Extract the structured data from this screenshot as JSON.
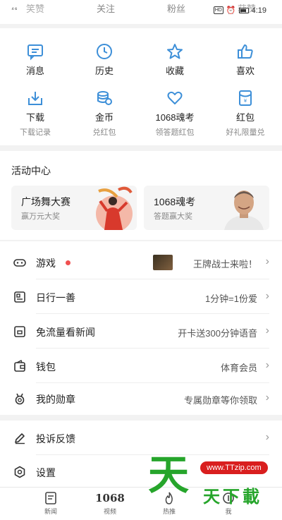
{
  "top_tabs": [
    "关注",
    "粉丝"
  ],
  "top_tabs_partial": [
    "笑赞",
    "获赞"
  ],
  "status": {
    "signal": "⁴⁶",
    "hd": "HD",
    "time": "4:19"
  },
  "grid": [
    {
      "label": "消息",
      "sub": "",
      "icon": "message-icon"
    },
    {
      "label": "历史",
      "sub": "",
      "icon": "clock-icon"
    },
    {
      "label": "收藏",
      "sub": "",
      "icon": "star-icon"
    },
    {
      "label": "喜欢",
      "sub": "",
      "icon": "thumbs-up-icon"
    },
    {
      "label": "下载",
      "sub": "下载记录",
      "icon": "download-icon"
    },
    {
      "label": "金币",
      "sub": "兑红包",
      "icon": "coin-icon"
    },
    {
      "label": "1068魂考",
      "sub": "领答题红包",
      "icon": "heart-icon"
    },
    {
      "label": "红包",
      "sub": "好礼限量兑",
      "icon": "red-packet-icon"
    }
  ],
  "activity": {
    "title": "活动中心",
    "cards": [
      {
        "name": "广场舞大赛",
        "sub": "赢万元大奖"
      },
      {
        "name": "1068魂考",
        "sub": "答题赢大奖"
      }
    ]
  },
  "list": [
    {
      "label": "游戏",
      "value": "王牌战士来啦！",
      "icon": "gamepad-icon"
    },
    {
      "label": "日行一善",
      "value": "1分钟=1份爱",
      "icon": "charity-icon"
    },
    {
      "label": "免流量看新闻",
      "value": "开卡送300分钟语音",
      "icon": "sim-card-icon"
    },
    {
      "label": "钱包",
      "value": "体育会员",
      "icon": "wallet-icon"
    },
    {
      "label": "我的勋章",
      "value": "专属勋章等你领取",
      "icon": "medal-icon"
    }
  ],
  "list2": [
    {
      "label": "投诉反馈",
      "value": "",
      "icon": "pencil-icon"
    },
    {
      "label": "设置",
      "value": "",
      "icon": "settings-icon"
    }
  ],
  "nav": [
    {
      "label": "新闻",
      "icon": "news-icon"
    },
    {
      "label": "视频",
      "icon": "video-1068-icon",
      "glyph": "1068"
    },
    {
      "label": "热推",
      "icon": "hot-icon"
    },
    {
      "label": "我",
      "icon": "me-icon"
    }
  ],
  "watermark": {
    "url": "www.TTzip.com",
    "big": "天",
    "text": "天下載"
  },
  "colors": {
    "accent": "#3d8fd8",
    "dot": "#f05050",
    "watermark_green": "#26a52b",
    "watermark_red": "#d91e1e"
  }
}
